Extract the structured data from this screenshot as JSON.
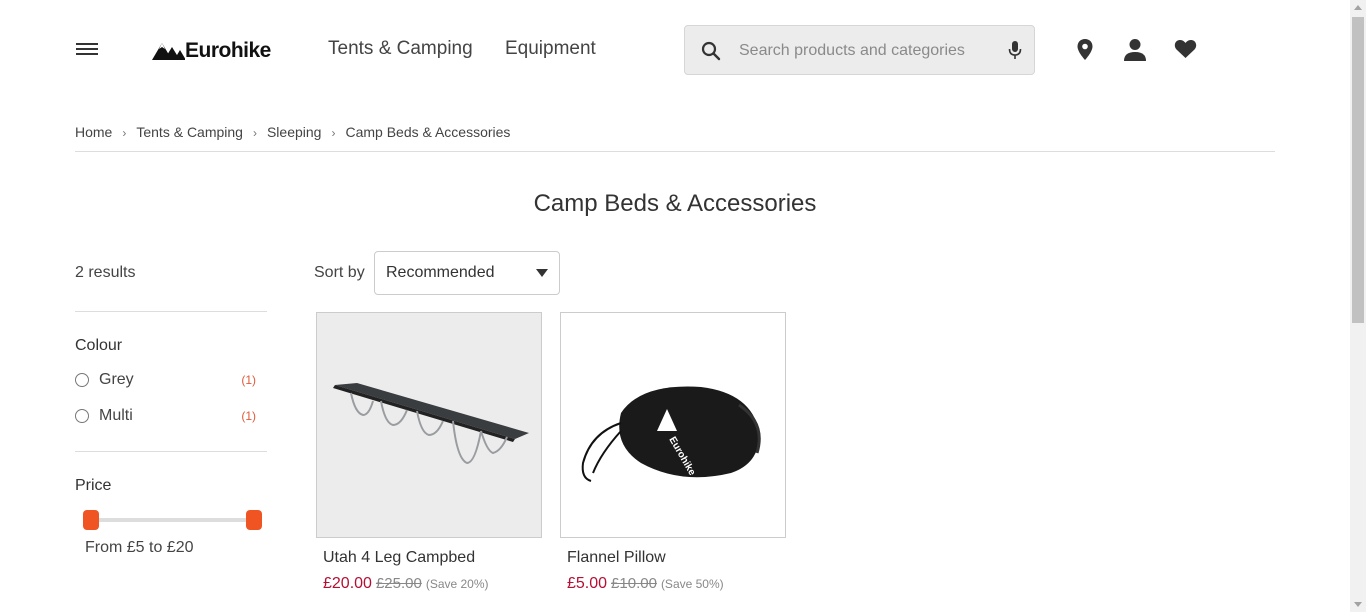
{
  "header": {
    "menu_icon": "hamburger-menu-icon",
    "logo_text": "Eurohike",
    "nav": [
      "Tents & Camping",
      "Equipment"
    ],
    "search_placeholder": "Search products and categories",
    "icons": [
      "search-icon",
      "microphone-icon",
      "location-pin-icon",
      "account-icon",
      "heart-icon"
    ]
  },
  "breadcrumb": [
    "Home",
    "Tents & Camping",
    "Sleeping",
    "Camp Beds & Accessories"
  ],
  "breadcrumb_separator": "›",
  "page_title": "Camp Beds & Accessories",
  "results": {
    "count_label": "2 results"
  },
  "filters": {
    "colour": {
      "heading": "Colour",
      "options": [
        {
          "label": "Grey",
          "count": "(1)"
        },
        {
          "label": "Multi",
          "count": "(1)"
        }
      ]
    },
    "price": {
      "heading": "Price",
      "range_label": "From £5 to £20",
      "min": 5,
      "max": 20
    }
  },
  "sort": {
    "label": "Sort by",
    "selected": "Recommended"
  },
  "products": [
    {
      "name": "Utah 4 Leg Campbed",
      "price": "£20.00",
      "was_price": "£25.00",
      "save": "(Save 20%)"
    },
    {
      "name": "Flannel Pillow",
      "price": "£5.00",
      "was_price": "£10.00",
      "save": "(Save 50%)"
    }
  ],
  "colors": {
    "accent": "#f05423",
    "sale_price": "#b50f33",
    "filter_count": "#e05a3a"
  }
}
